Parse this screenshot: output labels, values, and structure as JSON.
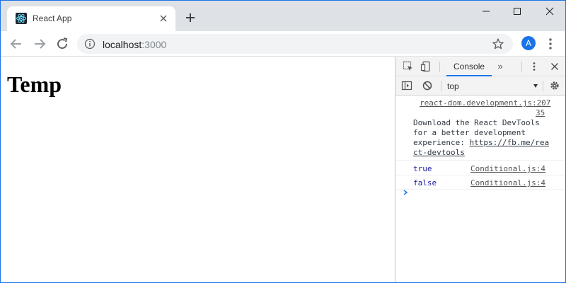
{
  "browser": {
    "tab": {
      "title": "React App",
      "favicon": "react-logo-icon"
    },
    "window_controls": [
      "minimize",
      "maximize",
      "close"
    ],
    "omnibox": {
      "host": "localhost",
      "port": ":3000"
    },
    "profile": {
      "initial": "A",
      "color": "#1a73e8"
    }
  },
  "page": {
    "heading": "Temp"
  },
  "devtools": {
    "active_tab": "Console",
    "context": "top",
    "messages": [
      {
        "source_line1": "react-dom.development.js:207",
        "source_line2": "35",
        "text_lines": [
          "Download the React DevTools",
          "for a better development",
          "experience: "
        ],
        "link_line1": "https://fb.me/rea",
        "link_line2": "ct-devtools"
      },
      {
        "value": "true",
        "source": "Conditional.js:4"
      },
      {
        "value": "false",
        "source": "Conditional.js:4"
      }
    ]
  },
  "colors": {
    "accent": "#1a73e8",
    "value_blue": "#1a1aa6",
    "titlebar": "#dee1e6"
  }
}
